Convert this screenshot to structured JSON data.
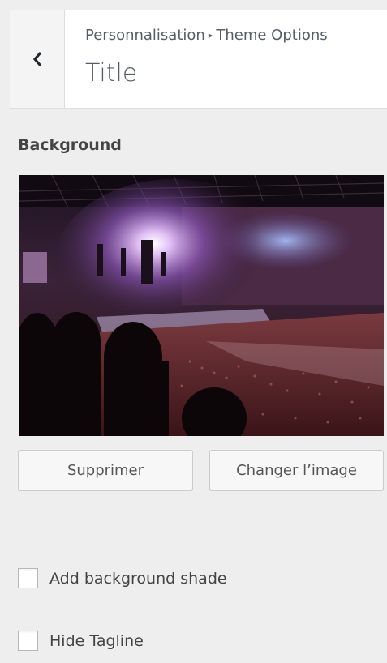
{
  "header": {
    "back_icon": "chevron-left-icon",
    "breadcrumb_parent": "Personnalisation",
    "breadcrumb_separator": "▸",
    "breadcrumb_current": "Theme Options",
    "title": "Title"
  },
  "background_section": {
    "title": "Background",
    "image_alt": "Concert arena crowd with stage lights",
    "remove_label": "Supprimer",
    "change_label": "Changer l’image"
  },
  "options": [
    {
      "label": "Add background shade",
      "checked": false
    },
    {
      "label": "Hide Tagline",
      "checked": false
    }
  ]
}
